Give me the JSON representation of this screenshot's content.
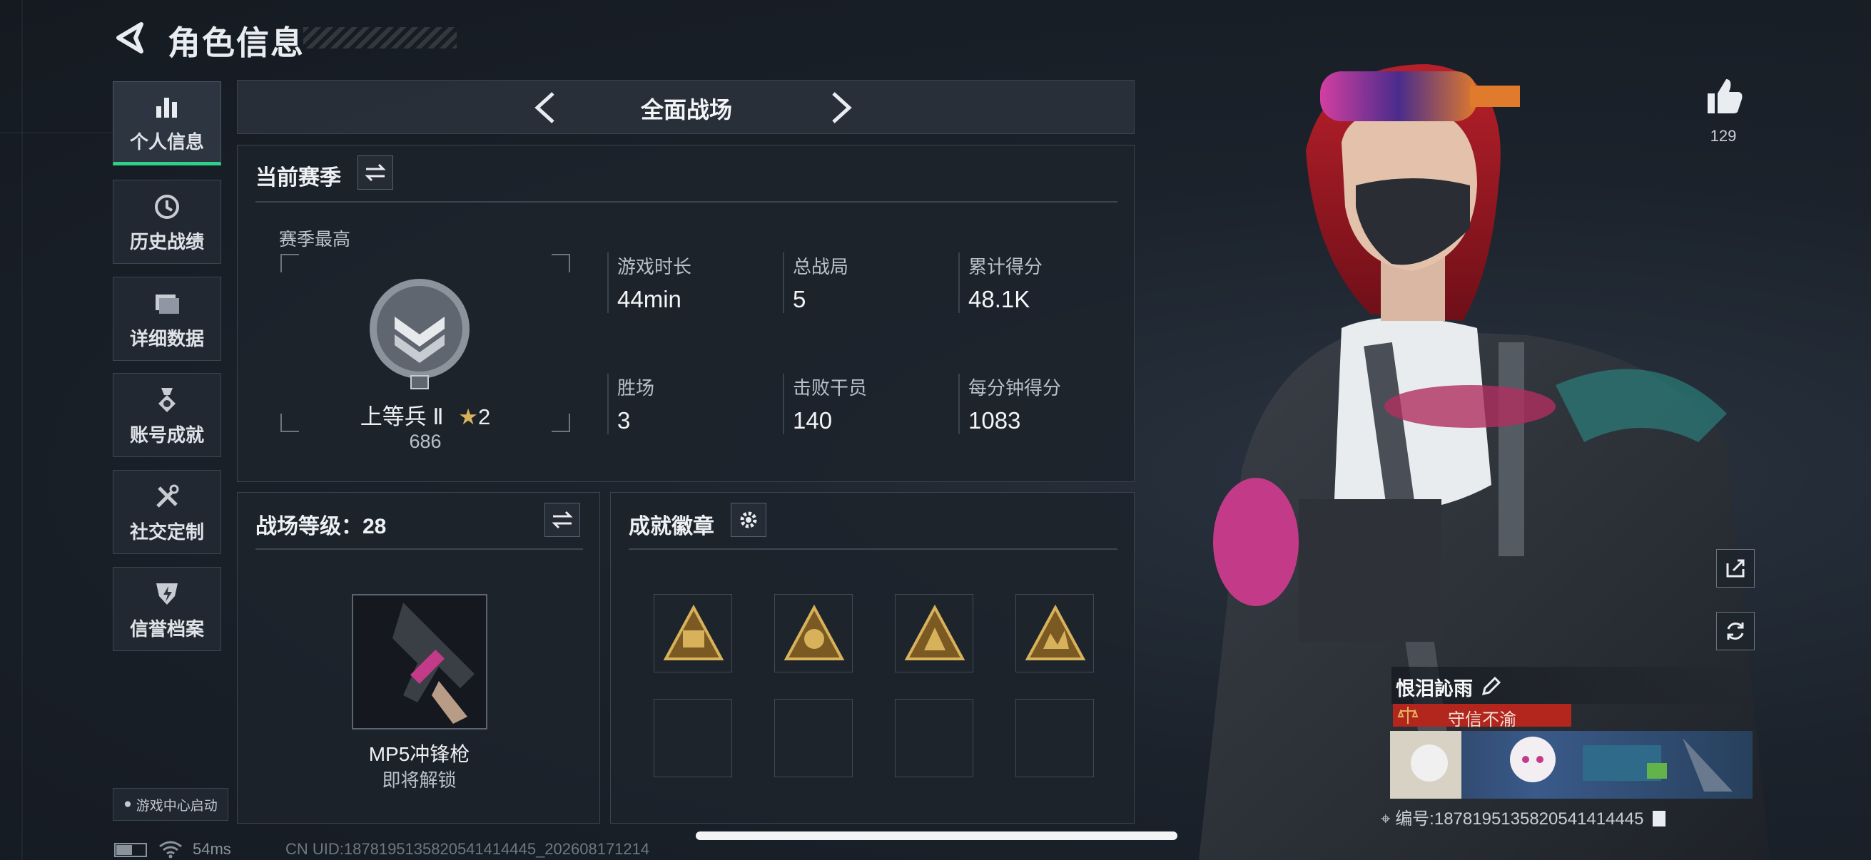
{
  "header": {
    "title": "角色信息"
  },
  "sidebar": {
    "items": [
      {
        "label": "个人信息",
        "icon": "bar-chart-icon",
        "active": true
      },
      {
        "label": "历史战绩",
        "icon": "history-icon"
      },
      {
        "label": "详细数据",
        "icon": "folder-icon"
      },
      {
        "label": "账号成就",
        "icon": "medal-icon"
      },
      {
        "label": "社交定制",
        "icon": "tools-icon"
      },
      {
        "label": "信誉档案",
        "icon": "shield-bolt-icon"
      }
    ],
    "game_center": "游戏中心启动"
  },
  "mode_selector": {
    "label": "全面战场"
  },
  "season": {
    "title": "当前赛季",
    "best_label": "赛季最高",
    "rank_name": "上等兵 Ⅱ",
    "rank_stars": "2",
    "rank_points": "686",
    "stats": [
      {
        "label": "游戏时长",
        "value": "44min"
      },
      {
        "label": "总战局",
        "value": "5"
      },
      {
        "label": "累计得分",
        "value": "48.1K"
      },
      {
        "label": "胜场",
        "value": "3"
      },
      {
        "label": "击败干员",
        "value": "140"
      },
      {
        "label": "每分钟得分",
        "value": "1083"
      }
    ]
  },
  "battlefield_level": {
    "title": "战场等级：28",
    "weapon_name": "MP5冲锋枪",
    "weapon_status": "即将解锁"
  },
  "achievements": {
    "title": "成就徽章"
  },
  "profile": {
    "likes": "129",
    "player_name": "恨泪訫雨",
    "title_tag": "守信不渝",
    "uid_label": "编号:1878195135820541414445"
  },
  "status_bar": {
    "ping": "54ms",
    "uid": "CN UID:1878195135820541414445_202608171214"
  },
  "colors": {
    "accent_green": "#2fd18a",
    "tag_red": "#b3261e",
    "rank_gold": "#d8b25a"
  }
}
